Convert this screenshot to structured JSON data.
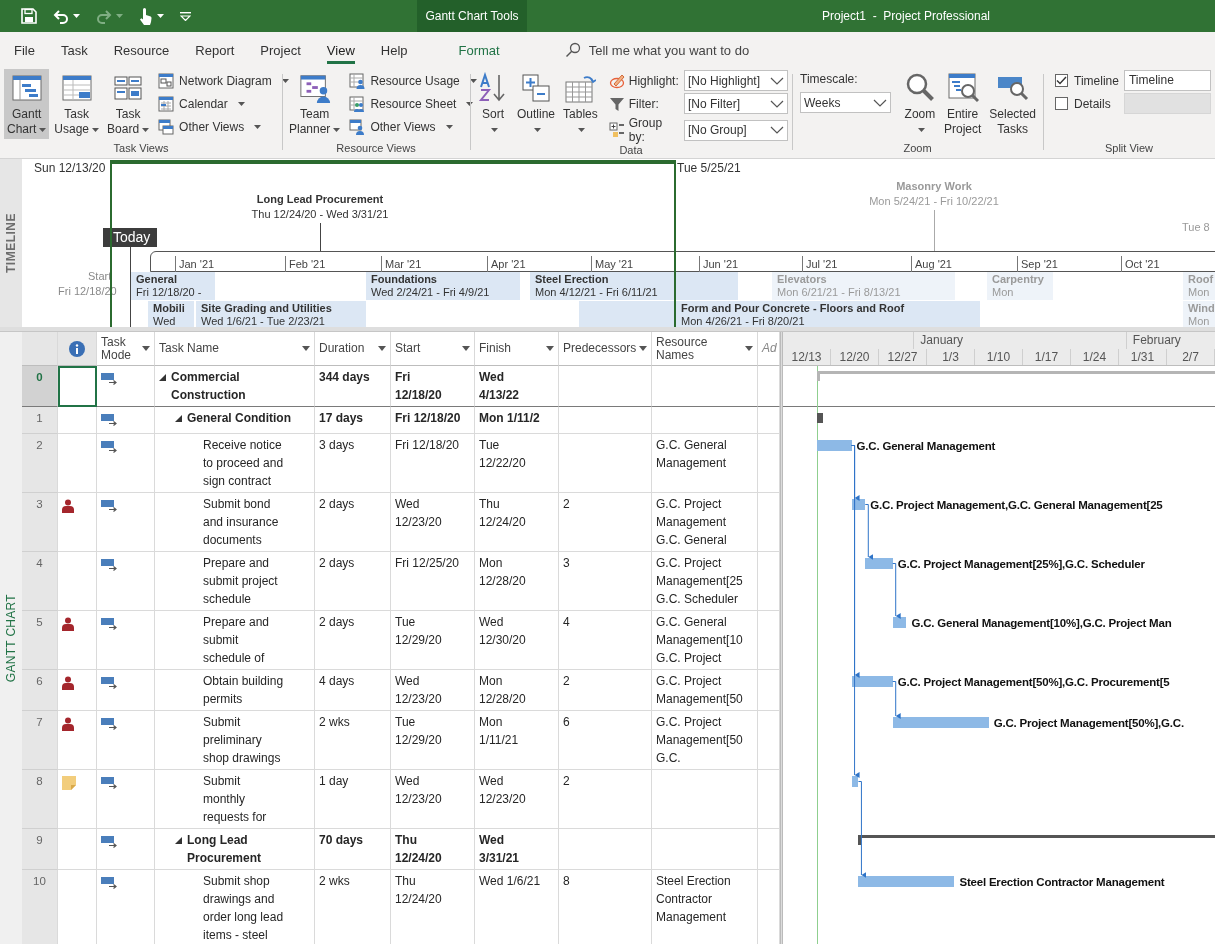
{
  "title_bar": {
    "quick_access": [
      {
        "kind": "save",
        "disabled": false
      },
      {
        "kind": "undo",
        "disabled": false
      },
      {
        "kind": "redo",
        "disabled": true
      },
      {
        "kind": "touch",
        "disabled": false
      },
      {
        "kind": "customize",
        "disabled": false
      }
    ],
    "context_tab": "Gantt Chart Tools",
    "title": "Project1  -  Project Professional"
  },
  "menu_tabs": [
    {
      "label": "File",
      "kind": "normal",
      "selected": false
    },
    {
      "label": "Task",
      "kind": "normal",
      "selected": false
    },
    {
      "label": "Resource",
      "kind": "normal",
      "selected": false
    },
    {
      "label": "Report",
      "kind": "normal",
      "selected": false
    },
    {
      "label": "Project",
      "kind": "normal",
      "selected": false
    },
    {
      "label": "View",
      "kind": "normal",
      "selected": true
    },
    {
      "label": "Help",
      "kind": "normal",
      "selected": false
    },
    {
      "label": "Format",
      "kind": "contextual",
      "selected": false
    }
  ],
  "tell_me": "Tell me what you want to do",
  "ribbon": {
    "groups": [
      {
        "label": "Task Views",
        "items": [
          {
            "kind": "large",
            "label": "Gantt Chart",
            "dropdown": true,
            "selected": true
          },
          {
            "kind": "large",
            "label": "Task Usage",
            "dropdown": true,
            "selected": false
          },
          {
            "kind": "large",
            "label": "Task Board",
            "dropdown": true,
            "selected": false
          },
          {
            "kind": "stack",
            "items": [
              {
                "label": "Network Diagram",
                "dropdown": true
              },
              {
                "label": "Calendar",
                "dropdown": true
              },
              {
                "label": "Other Views",
                "dropdown": true
              }
            ]
          }
        ]
      },
      {
        "label": "Resource Views",
        "items": [
          {
            "kind": "large",
            "label": "Team Planner",
            "dropdown": true,
            "selected": false
          },
          {
            "kind": "stack",
            "items": [
              {
                "label": "Resource Usage",
                "dropdown": true
              },
              {
                "label": "Resource Sheet",
                "dropdown": true
              },
              {
                "label": "Other Views",
                "dropdown": true
              }
            ]
          }
        ]
      },
      {
        "label": "Data",
        "items": [
          {
            "kind": "large",
            "label": "Sort",
            "dropdown": true,
            "selected": false
          },
          {
            "kind": "large",
            "label": "Outline",
            "dropdown": true,
            "selected": false
          },
          {
            "kind": "large",
            "label": "Tables",
            "dropdown": true,
            "selected": false
          },
          {
            "kind": "fields",
            "items": [
              {
                "label": "Highlight:",
                "value": "[No Highlight]"
              },
              {
                "label": "Filter:",
                "value": "[No Filter]"
              },
              {
                "label": "Group by:",
                "value": "[No Group]"
              }
            ]
          }
        ]
      },
      {
        "label": "Zoom",
        "items": [
          {
            "kind": "timescale",
            "label": "Timescale:",
            "value": "Weeks"
          },
          {
            "kind": "large",
            "label": "Zoom",
            "dropdown": true,
            "selected": false
          },
          {
            "kind": "large",
            "label": "Entire Project",
            "dropdown": false,
            "selected": false
          },
          {
            "kind": "large",
            "label": "Selected Tasks",
            "dropdown": false,
            "selected": false
          }
        ]
      },
      {
        "label": "Split View",
        "items": [
          {
            "kind": "split",
            "items": [
              {
                "label": "Timeline",
                "checked": true,
                "value": "Timeline",
                "disabled": false
              },
              {
                "label": "Details",
                "checked": false,
                "disabled": true
              }
            ]
          }
        ]
      }
    ]
  },
  "timeline": {
    "side_label": "TIMELINE",
    "start_date": "Sun 12/13/20",
    "end_date": "Tue 5/25/21",
    "far_date": "Tue 8",
    "today_label": "Today",
    "start_label": "Start",
    "start_value": "Fri 12/18/20",
    "callouts": [
      {
        "title": "Long Lead Procurement",
        "dates": "Thu 12/24/20 - Wed 3/31/21",
        "in_view": true
      },
      {
        "title": "Masonry Work",
        "dates": "Mon 5/24/21 - Fri 10/22/21",
        "in_view": false
      }
    ],
    "months": [
      "Jan '21",
      "Feb '21",
      "Mar '21",
      "Apr '21",
      "May '21",
      "Jun '21",
      "Jul '21",
      "Aug '21",
      "Sep '21",
      "Oct '21"
    ],
    "tasks": [
      {
        "name": "General",
        "dates": "Fri 12/18/20 -",
        "in_view": true
      },
      {
        "name": "Foundations",
        "dates": "Wed 2/24/21 - Fri 4/9/21",
        "in_view": true
      },
      {
        "name": "Steel Erection",
        "dates": "Mon 4/12/21 - Fri 6/11/21",
        "in_view": true
      },
      {
        "name": "Elevators",
        "dates": "Mon 6/21/21 - Fri 8/13/21",
        "in_view": false
      },
      {
        "name": "Carpentry",
        "dates": "Mon",
        "in_view": false
      },
      {
        "name": "Roof",
        "dates": "Mon",
        "in_view": false
      },
      {
        "name": "Mobili",
        "dates": "Wed",
        "in_view": true
      },
      {
        "name": "Site Grading and Utilities",
        "dates": "Wed 1/6/21 - Tue 2/23/21",
        "in_view": true
      },
      {
        "name": "Form and Pour Concrete - Floors and Roof",
        "dates": "Mon 4/26/21 - Fri 8/20/21",
        "in_view": true
      },
      {
        "name": "Wind",
        "dates": "Mon",
        "in_view": false
      }
    ]
  },
  "gantt": {
    "side_label": "GANTT CHART",
    "columns": [
      {
        "kind": "indicator"
      },
      {
        "kind": "field",
        "label": "Task\nMode",
        "filter": true
      },
      {
        "kind": "field",
        "label": "Task Name",
        "filter": true
      },
      {
        "kind": "field",
        "label": "Duration",
        "filter": true
      },
      {
        "kind": "field",
        "label": "Start",
        "filter": true
      },
      {
        "kind": "field",
        "label": "Finish",
        "filter": true
      },
      {
        "kind": "field",
        "label": "Predecessors",
        "filter": true
      },
      {
        "kind": "field",
        "label": "Resource\nNames",
        "filter": true
      },
      {
        "kind": "add",
        "label": "Ad"
      }
    ],
    "timescale": {
      "months": [
        "January",
        "February"
      ],
      "weeks": [
        "12/13",
        "12/20",
        "12/27",
        "1/3",
        "1/10",
        "1/17",
        "1/24",
        "1/31",
        "2/7"
      ]
    },
    "rows": [
      {
        "id": "0",
        "kind": "project",
        "selected": true,
        "expanded": true,
        "overallocated": false,
        "has_note": false,
        "name": "Commercial\nConstruction",
        "duration": "344 days",
        "start": "Fri\n12/18/20",
        "finish": "Wed\n4/13/22",
        "children": [
          {
            "id": "1",
            "kind": "summary",
            "selected": false,
            "expanded": true,
            "overallocated": false,
            "has_note": false,
            "name": "General Condition",
            "duration": "17 days",
            "start": "Fri 12/18/20",
            "finish": "Mon 1/11/2",
            "children": [
              {
                "id": "2",
                "kind": "task",
                "selected": false,
                "overallocated": false,
                "has_note": false,
                "name": "Receive notice\nto proceed and\nsign contract",
                "duration": "3 days",
                "start": "Fri 12/18/20",
                "finish": "Tue\n12/22/20",
                "resources": "G.C. General\nManagement",
                "bar_label": "G.C. General Management"
              },
              {
                "id": "3",
                "kind": "task",
                "selected": false,
                "overallocated": true,
                "has_note": false,
                "name": "Submit bond\nand insurance\ndocuments",
                "duration": "2 days",
                "start": "Wed\n12/23/20",
                "finish": "Thu\n12/24/20",
                "predecessors": "2",
                "resources": "G.C. Project\nManagement\nG.C. General",
                "bar_label": "G.C. Project Management,G.C. General Management[25"
              },
              {
                "id": "4",
                "kind": "task",
                "selected": false,
                "overallocated": false,
                "has_note": false,
                "name": "Prepare and\nsubmit project\nschedule",
                "duration": "2 days",
                "start": "Fri 12/25/20",
                "finish": "Mon\n12/28/20",
                "predecessors": "3",
                "resources": "G.C. Project\nManagement[25\nG.C. Scheduler",
                "bar_label": "G.C. Project Management[25%],G.C. Scheduler"
              },
              {
                "id": "5",
                "kind": "task",
                "selected": false,
                "overallocated": true,
                "has_note": false,
                "name": "Prepare and\nsubmit\nschedule of",
                "duration": "2 days",
                "start": "Tue\n12/29/20",
                "finish": "Wed\n12/30/20",
                "predecessors": "4",
                "resources": "G.C. General\nManagement[10\nG.C. Project",
                "bar_label": "G.C. General Management[10%],G.C. Project Man"
              },
              {
                "id": "6",
                "kind": "task",
                "selected": false,
                "overallocated": true,
                "has_note": false,
                "name": "Obtain building\npermits",
                "duration": "4 days",
                "start": "Wed\n12/23/20",
                "finish": "Mon\n12/28/20",
                "predecessors": "2",
                "resources": "G.C. Project\nManagement[50",
                "bar_label": "G.C. Project Management[50%],G.C. Procurement[5"
              },
              {
                "id": "7",
                "kind": "task",
                "selected": false,
                "overallocated": true,
                "has_note": false,
                "name": "Submit\npreliminary\nshop drawings",
                "duration": "2 wks",
                "start": "Tue\n12/29/20",
                "finish": "Mon\n1/11/21",
                "predecessors": "6",
                "resources": "G.C. Project\nManagement[50\nG.C.",
                "bar_label": "G.C. Project Management[50%],G.C."
              },
              {
                "id": "8",
                "kind": "task",
                "selected": false,
                "overallocated": false,
                "has_note": true,
                "name": "Submit\nmonthly\nrequests for",
                "duration": "1 day",
                "start": "Wed\n12/23/20",
                "finish": "Wed\n12/23/20",
                "predecessors": "2"
              }
            ]
          },
          {
            "id": "9",
            "kind": "summary",
            "selected": false,
            "expanded": true,
            "overallocated": false,
            "has_note": false,
            "name": "Long Lead\nProcurement",
            "duration": "70 days",
            "start": "Thu\n12/24/20",
            "finish": "Wed\n3/31/21",
            "children": [
              {
                "id": "10",
                "kind": "task",
                "selected": false,
                "overallocated": false,
                "has_note": false,
                "name": "Submit shop\ndrawings and\norder long lead\nitems - steel",
                "duration": "2 wks",
                "start": "Thu\n12/24/20",
                "finish": "Wed 1/6/21",
                "predecessors": "8",
                "resources": "Steel Erection\nContractor\nManagement",
                "bar_label": "Steel Erection Contractor Management"
              }
            ]
          }
        ]
      }
    ]
  }
}
